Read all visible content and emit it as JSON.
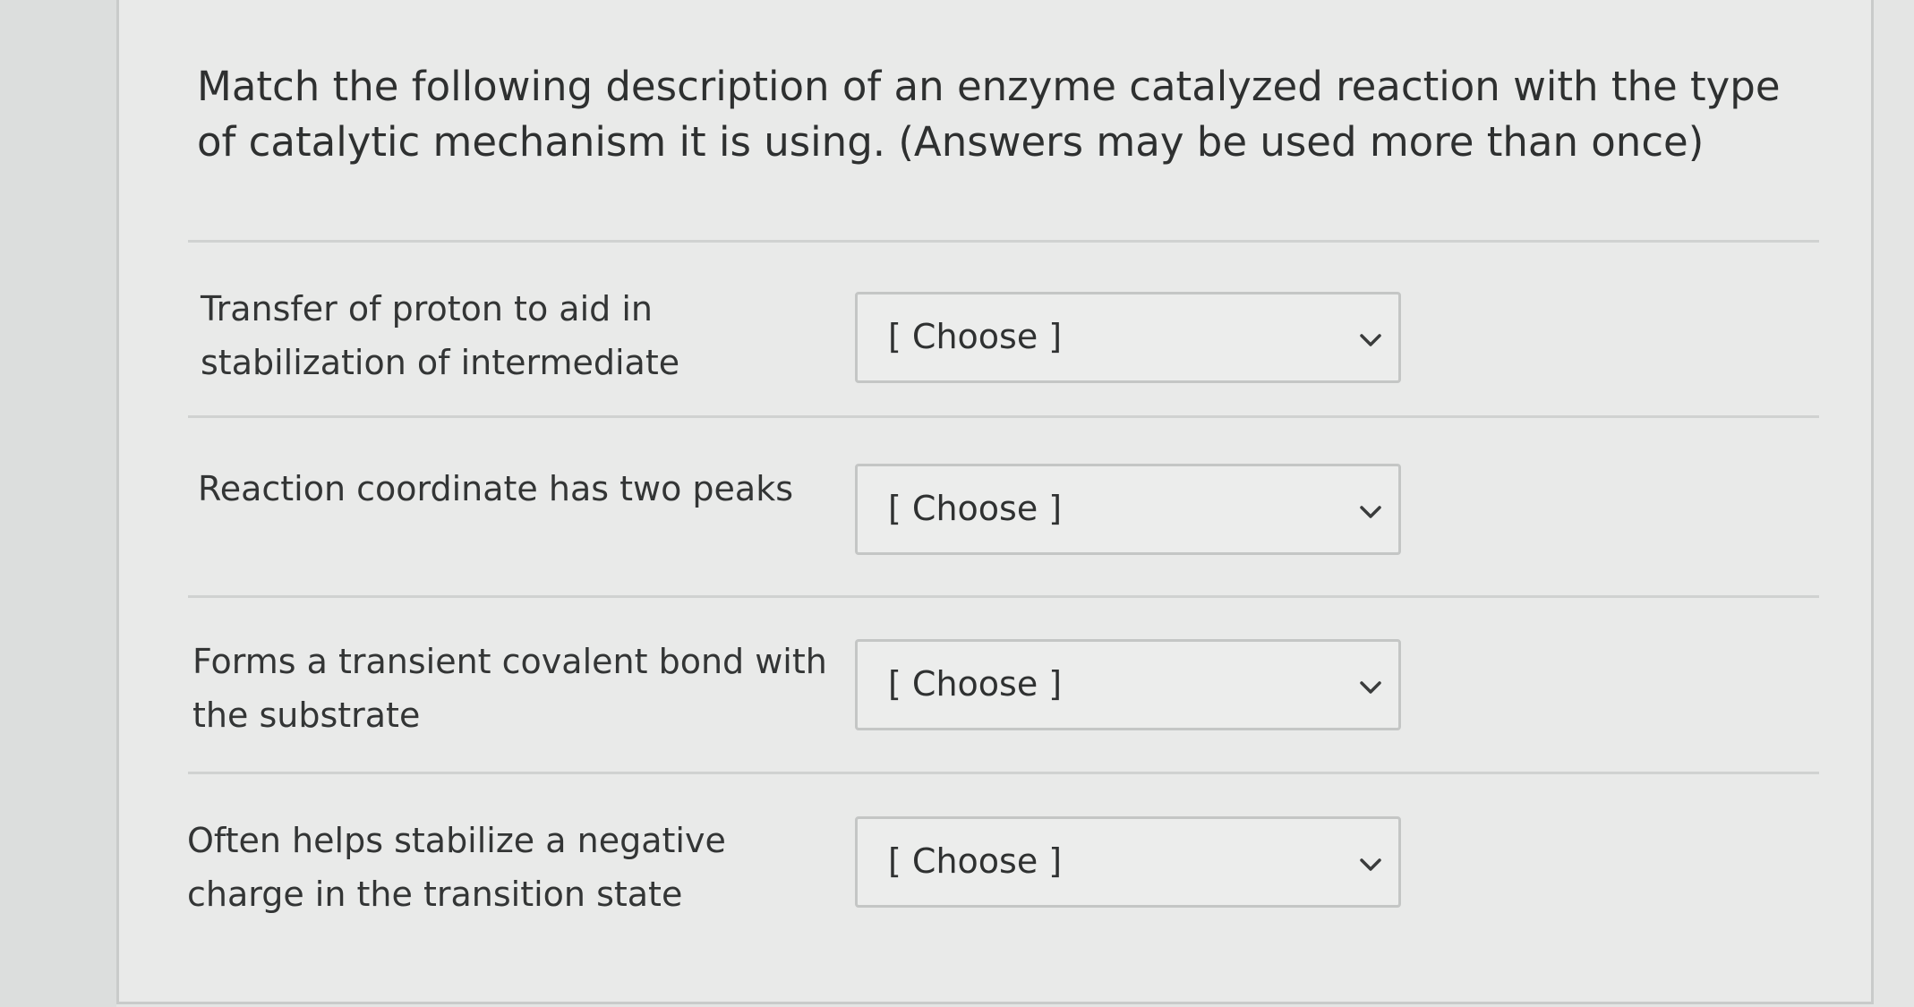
{
  "question": {
    "prompt": "Match the following description of an enzyme catalyzed reaction with the type of catalytic mechanism it is using. (Answers may be used more than once)"
  },
  "rows": [
    {
      "label": "Transfer of proton to aid in stabilization of intermediate",
      "selected": "[ Choose ]"
    },
    {
      "label": "Reaction coordinate has two peaks",
      "selected": "[ Choose ]"
    },
    {
      "label": "Forms a transient covalent bond with the substrate",
      "selected": "[ Choose ]"
    },
    {
      "label": "Often helps stabilize a negative charge in the transition state",
      "selected": "[ Choose ]"
    }
  ],
  "icons": {
    "dropdown": "chevron-down-icon"
  }
}
